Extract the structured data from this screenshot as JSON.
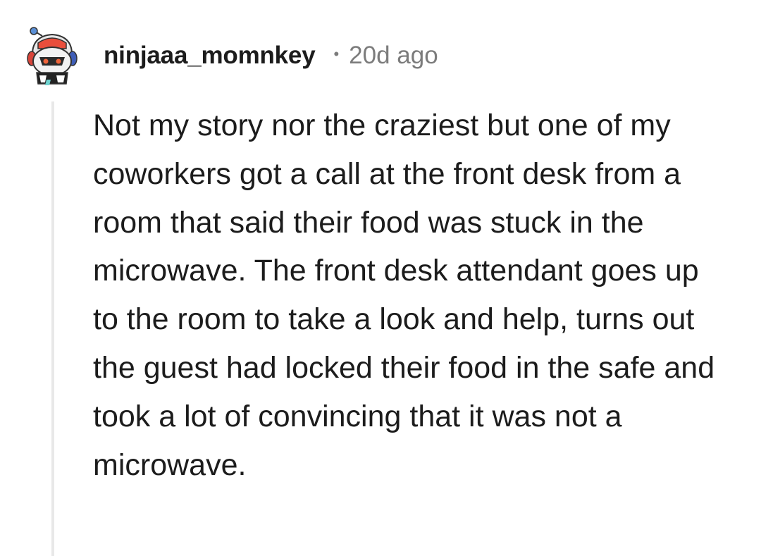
{
  "comment": {
    "author": "ninjaaa_momnkey",
    "separator": "•",
    "age": "20d ago",
    "avatar_icon": "snoo-avatar-icon",
    "body": "Not my story nor the craziest but one of my coworkers got a call at the front desk from a room that said their food was stuck in the microwave. The front desk attendant goes up to the room to take a look and help, turns out the guest had locked their food in the safe and took a lot of convincing that it was not a microwave."
  },
  "colors": {
    "text": "#1c1c1c",
    "meta": "#7c7c7c",
    "thread_line": "#e8e8e8",
    "background": "#ffffff"
  }
}
